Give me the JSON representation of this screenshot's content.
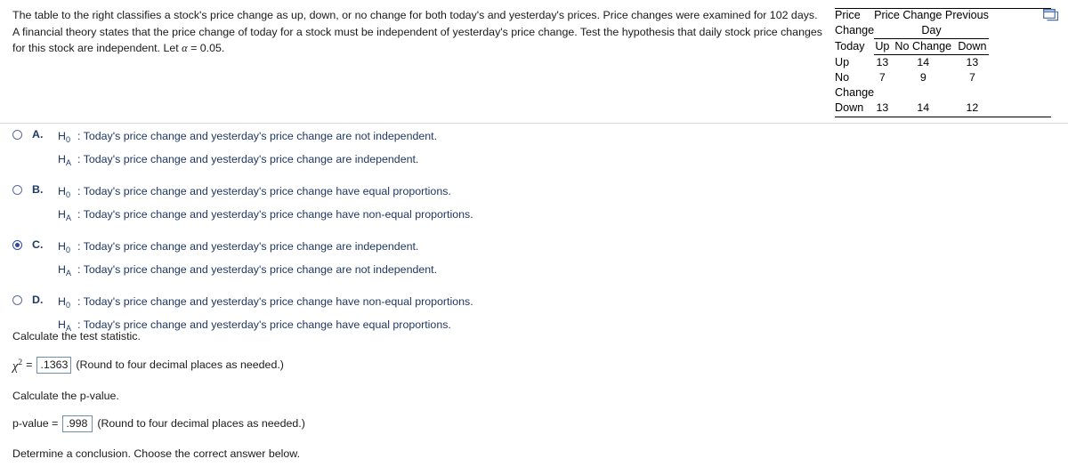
{
  "problem": {
    "text_part1": "The table to the right classifies a stock's price change as up, down, or no change for both today's and yesterday's prices. Price changes were examined for 102 days. A financial theory states that the price change of today for a stock must be independent of yesterday's price change. Test the hypothesis that daily stock price changes for this stock are independent. Let ",
    "alpha_symbol": "α",
    "text_part2": " = 0.05."
  },
  "data_table": {
    "row_label_header": [
      "Price",
      "Change",
      "Today"
    ],
    "group_header": [
      "Price Change Previous",
      "Day"
    ],
    "column_headers": [
      "Up",
      "No Change",
      "Down"
    ],
    "rows": [
      {
        "label_lines": [
          "Up"
        ],
        "values": [
          13,
          14,
          13
        ]
      },
      {
        "label_lines": [
          "No",
          "Change"
        ],
        "values": [
          7,
          9,
          7
        ]
      },
      {
        "label_lines": [
          "Down"
        ],
        "values": [
          13,
          14,
          12
        ]
      }
    ],
    "popout_icon": "popout-window-icon"
  },
  "options": {
    "selected": "C",
    "items": [
      {
        "letter": "A.",
        "h0_label": "H",
        "h0_sub": "0",
        "h0_text": ": Today's price change and yesterday's price change are not independent.",
        "ha_label": "H",
        "ha_sub": "A",
        "ha_text": ": Today's price change and yesterday's price change are independent."
      },
      {
        "letter": "B.",
        "h0_label": "H",
        "h0_sub": "0",
        "h0_text": ": Today's price change and yesterday's price change have equal proportions.",
        "ha_label": "H",
        "ha_sub": "A",
        "ha_text": ": Today's price change and yesterday's price change have non-equal proportions."
      },
      {
        "letter": "C.",
        "h0_label": "H",
        "h0_sub": "0",
        "h0_text": ": Today's price change and yesterday's price change are independent.",
        "ha_label": "H",
        "ha_sub": "A",
        "ha_text": ": Today's price change and yesterday's price change are not independent."
      },
      {
        "letter": "D.",
        "h0_label": "H",
        "h0_sub": "0",
        "h0_text": ": Today's price change and yesterday's price change have non-equal proportions.",
        "ha_label": "H",
        "ha_sub": "A",
        "ha_text": ": Today's price change and yesterday's price change have equal proportions."
      }
    ]
  },
  "test_statistic": {
    "prompt": "Calculate the test statistic.",
    "symbol": "χ",
    "exponent": "2",
    "equals": "=",
    "value": ".1363",
    "note": "(Round to four decimal places as needed.)"
  },
  "p_value": {
    "prompt": "Calculate the p-value.",
    "label": "p-value =",
    "value": ".998",
    "note": "(Round to four decimal places as needed.)"
  },
  "conclusion": {
    "prompt": "Determine a conclusion. Choose the correct answer below."
  },
  "colors": {
    "option_text": "#1f3864",
    "radio_selected": "#2d4a9e",
    "input_border": "#6f8fb0",
    "divider": "#d9d9d9"
  }
}
